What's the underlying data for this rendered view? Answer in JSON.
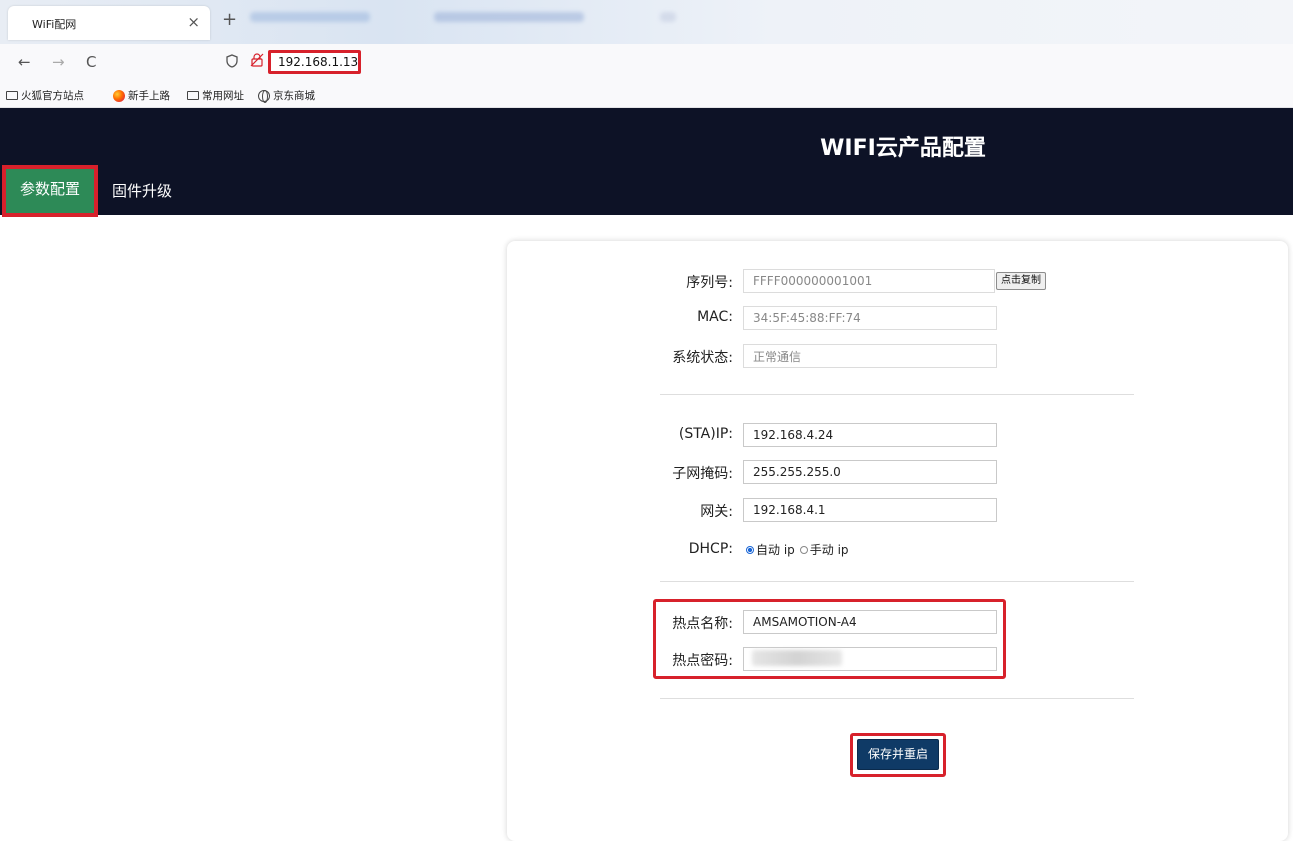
{
  "browser": {
    "tab_title": "WiFi配网",
    "tab_close": "×",
    "new_tab": "+",
    "url": "192.168.1.13",
    "nav": {
      "back": "←",
      "forward": "→",
      "reload": "C"
    },
    "bookmarks": [
      {
        "label": "火狐官方站点",
        "icon": "folder-icon"
      },
      {
        "label": "新手上路",
        "icon": "firefox-icon"
      },
      {
        "label": "常用网址",
        "icon": "folder-icon"
      },
      {
        "label": "京东商城",
        "icon": "globe-icon"
      }
    ]
  },
  "app": {
    "title": "WIFI云产品配置",
    "menu": [
      {
        "label": "参数配置",
        "active": true
      },
      {
        "label": "固件升级",
        "active": false
      }
    ]
  },
  "form": {
    "serial": {
      "label": "序列号:",
      "value": "FFFF000000001001",
      "copy_button": "点击复制"
    },
    "mac": {
      "label": "MAC:",
      "value": "34:5F:45:88:FF:74"
    },
    "status": {
      "label": "系统状态:",
      "value": "正常通信"
    },
    "sta_ip": {
      "label": "(STA)IP:",
      "value": "192.168.4.24"
    },
    "netmask": {
      "label": "子网掩码:",
      "value": "255.255.255.0"
    },
    "gateway": {
      "label": "网关:",
      "value": "192.168.4.1"
    },
    "dhcp": {
      "label": "DHCP:",
      "options": [
        "自动 ip",
        "手动 ip"
      ],
      "selected": "自动 ip"
    },
    "hotspot_name": {
      "label": "热点名称:",
      "value": "AMSAMOTION-A4"
    },
    "hotspot_password": {
      "label": "热点密码:"
    },
    "save_button": "保存并重启"
  },
  "colors": {
    "header_bg": "#0d1226",
    "active_menu_bg": "#2d8a57",
    "highlight": "#d7212b",
    "save_button_bg": "#0f3a66"
  }
}
